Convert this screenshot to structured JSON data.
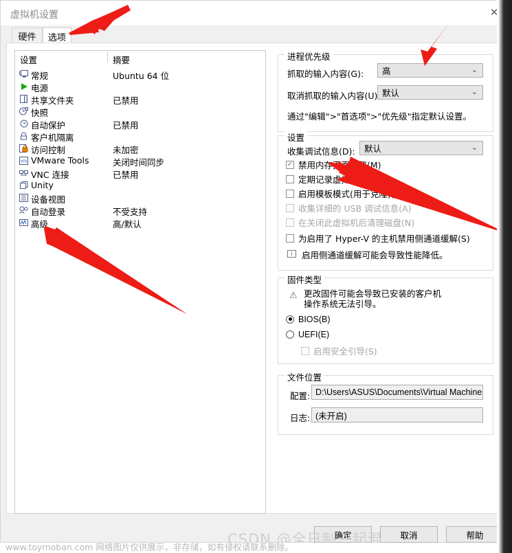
{
  "window": {
    "title": "虚拟机设置",
    "close_label": "✕"
  },
  "tabs": [
    {
      "label": "硬件",
      "selected": false
    },
    {
      "label": "选项",
      "selected": true
    }
  ],
  "settings_list": {
    "headers": {
      "setting": "设置",
      "summary": "摘要"
    },
    "rows": [
      {
        "icon": "monitor-icon",
        "glyph": "🖳",
        "label": "常规",
        "summary": "Ubuntu 64 位"
      },
      {
        "icon": "power-play-icon",
        "glyph": "▶",
        "label": "电源",
        "summary": ""
      },
      {
        "icon": "folder-share-icon",
        "glyph": "◫",
        "label": "共享文件夹",
        "summary": "已禁用"
      },
      {
        "icon": "snapshot-clock-icon",
        "glyph": "◐",
        "label": "快照",
        "summary": ""
      },
      {
        "icon": "autoprotect-clock-icon",
        "glyph": "◷",
        "label": "自动保护",
        "summary": "已禁用"
      },
      {
        "icon": "lock-icon",
        "glyph": "🔒",
        "label": "客户机隔离",
        "summary": ""
      },
      {
        "icon": "access-control-lock-icon",
        "glyph": "▤",
        "label": "访问控制",
        "summary": "未加密"
      },
      {
        "icon": "vmware-tools-icon",
        "glyph": "vm",
        "label": "VMware Tools",
        "summary": "关闭时间同步"
      },
      {
        "icon": "vnc-icon",
        "glyph": "▦",
        "label": "VNC 连接",
        "summary": "已禁用"
      },
      {
        "icon": "unity-window-icon",
        "glyph": "❐",
        "label": "Unity",
        "summary": ""
      },
      {
        "icon": "device-view-icon",
        "glyph": "▩",
        "label": "设备视图",
        "summary": ""
      },
      {
        "icon": "auto-login-icon",
        "glyph": "⚲",
        "label": "自动登录",
        "summary": "不受支持"
      },
      {
        "icon": "advanced-wave-icon",
        "glyph": "〰",
        "label": "高级",
        "summary": "高/默认"
      }
    ]
  },
  "process_priority": {
    "title": "进程优先级",
    "grab_label": "抓取的输入内容(G):",
    "grab_value": "高",
    "ungrab_label": "取消抓取的输入内容(U):",
    "ungrab_value": "默认",
    "hint": "通过\"编辑\">\"首选项\">\"优先级\"指定默认设置。",
    "chevron": "⌄"
  },
  "settings_group": {
    "title": "设置",
    "debug_label": "收集调试信息(D):",
    "debug_value": "默认",
    "chevron": "⌄",
    "checkboxes": [
      {
        "label": "禁用内存页面修整(M)",
        "checked": true,
        "disabled": false
      },
      {
        "label": "定期记录虚拟机进度(L)",
        "checked": false,
        "disabled": false
      },
      {
        "label": "启用模板模式(用于克隆)(T)",
        "checked": false,
        "disabled": false
      },
      {
        "label": "收集详细的 USB 调试信息(A)",
        "checked": false,
        "disabled": true
      },
      {
        "label": "在关闭此虚拟机后清理磁盘(N)",
        "checked": false,
        "disabled": true
      },
      {
        "label": "为启用了 Hyper-V 的主机禁用侧通道缓解(S)",
        "checked": false,
        "disabled": false
      }
    ],
    "info_note": "启用侧通道缓解可能会导致性能降低。",
    "info_icon_glyph": "i"
  },
  "firmware": {
    "title": "固件类型",
    "warning": "更改固件可能会导致已安装的客户机\n操作系统无法引导。",
    "warning_icon_glyph": "⚠",
    "options": [
      {
        "label": "BIOS(B)",
        "selected": true
      },
      {
        "label": "UEFI(E)",
        "selected": false
      }
    ],
    "secure_boot": {
      "label": "启用安全引导(S)",
      "checked": false,
      "disabled": true
    }
  },
  "file_location": {
    "title": "文件位置",
    "config_label": "配置:",
    "config_value": "D:\\Users\\ASUS\\Documents\\Virtual Machines\\",
    "log_label": "日志:",
    "log_value": "(未开启)"
  },
  "buttons": {
    "ok": "确定",
    "cancel": "取消",
    "help": "帮助"
  },
  "watermarks": {
    "csdn": "CSDN @全日制一起混",
    "bottom": "www.toymoban.com 网络图片仅供展示，非存储，如有侵权请联系删除。"
  },
  "annotations": {
    "arrow_color": "#ee1c16",
    "arrows": [
      {
        "name": "arrow-to-options-tab"
      },
      {
        "name": "arrow-to-grab-input-dropdown"
      },
      {
        "name": "arrow-to-disable-memory-trim-checkbox"
      },
      {
        "name": "arrow-to-advanced-list-item"
      }
    ]
  }
}
